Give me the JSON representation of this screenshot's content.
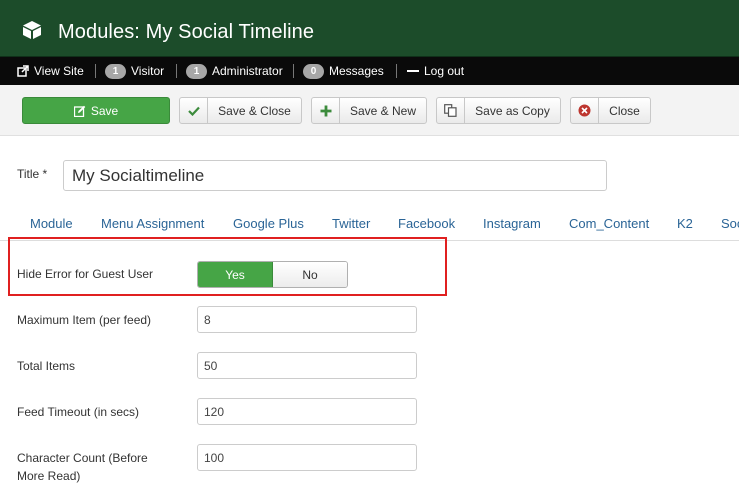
{
  "header": {
    "title": "Modules: My Social Timeline"
  },
  "statusbar": {
    "view_site": "View Site",
    "visitor_count": "1",
    "visitor_label": "Visitor",
    "admin_count": "1",
    "admin_label": "Administrator",
    "messages_count": "0",
    "messages_label": "Messages",
    "logout": "Log out"
  },
  "toolbar": {
    "save": "Save",
    "save_close": "Save & Close",
    "save_new": "Save & New",
    "save_copy": "Save as Copy",
    "close": "Close"
  },
  "form": {
    "title_label": "Title *",
    "title_value": "My Socialtimeline"
  },
  "tabs": [
    "Module",
    "Menu Assignment",
    "Google Plus",
    "Twitter",
    "Facebook",
    "Instagram",
    "Com_Content",
    "K2",
    "Soc"
  ],
  "fields": {
    "hide_error": {
      "label": "Hide Error for Guest User",
      "yes": "Yes",
      "no": "No",
      "selected": "Yes"
    },
    "max_item": {
      "label": "Maximum Item (per feed)",
      "value": "8"
    },
    "total_items": {
      "label": "Total Items",
      "value": "50"
    },
    "feed_timeout": {
      "label": "Feed Timeout (in secs)",
      "value": "120"
    },
    "char_count": {
      "label_line1": "Character Count (Before",
      "label_line2": "More Read)",
      "value": "100"
    }
  },
  "colors": {
    "header_bg": "#1c4c2a",
    "primary_green": "#46a546",
    "highlight_red": "#e02020",
    "tab_link": "#2a6496"
  }
}
